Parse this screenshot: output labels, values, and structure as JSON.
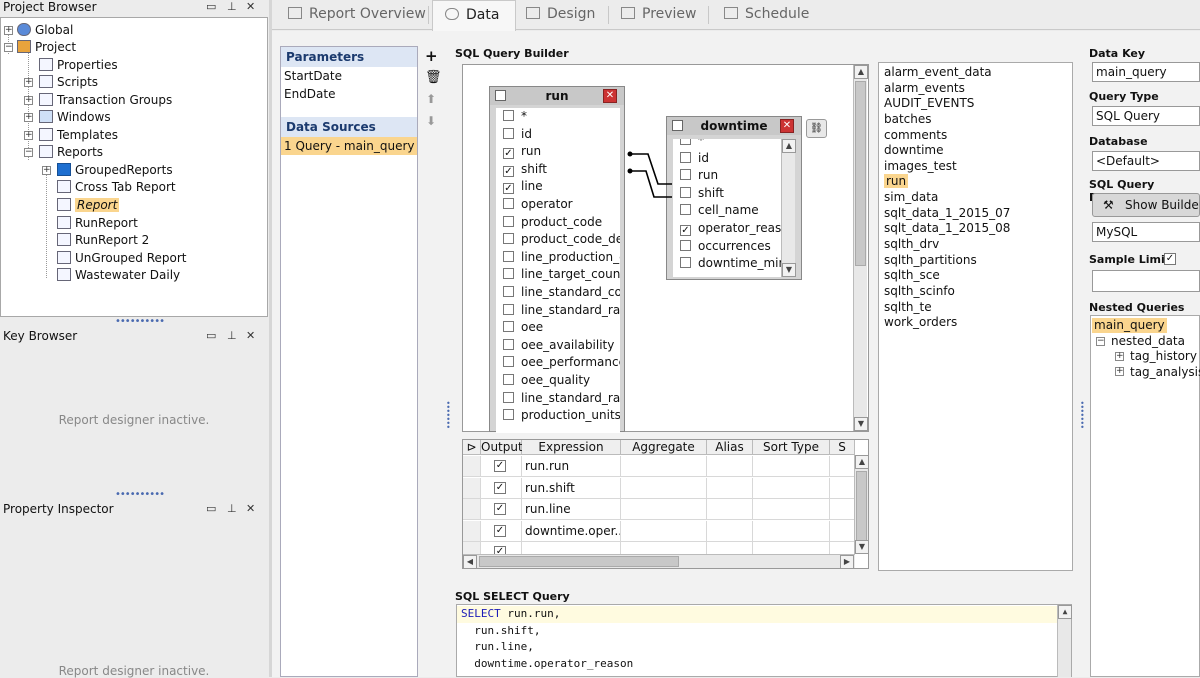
{
  "project_browser": {
    "title": "Project Browser",
    "items": [
      {
        "label": "Global"
      },
      {
        "label": "Project"
      },
      {
        "label": "Properties"
      },
      {
        "label": "Scripts"
      },
      {
        "label": "Transaction Groups"
      },
      {
        "label": "Windows"
      },
      {
        "label": "Templates"
      },
      {
        "label": "Reports"
      },
      {
        "label": "GroupedReports"
      },
      {
        "label": "Cross Tab Report"
      },
      {
        "label": "Report"
      },
      {
        "label": "RunReport"
      },
      {
        "label": "RunReport 2"
      },
      {
        "label": "UnGrouped Report"
      },
      {
        "label": "Wastewater Daily"
      }
    ]
  },
  "key_browser": {
    "title": "Key Browser",
    "inactive": "Report designer inactive."
  },
  "property_inspector": {
    "title": "Property Inspector",
    "inactive": "Report designer inactive."
  },
  "tabs": [
    {
      "label": "Report Overview",
      "icon": "overview-icon"
    },
    {
      "label": "Data",
      "icon": "database-icon"
    },
    {
      "label": "Design",
      "icon": "design-icon"
    },
    {
      "label": "Preview",
      "icon": "preview-icon"
    },
    {
      "label": "Schedule",
      "icon": "calendar-icon"
    }
  ],
  "parameters": {
    "title": "Parameters",
    "items": [
      "StartDate",
      "EndDate"
    ],
    "data_sources_title": "Data Sources",
    "data_sources": [
      "1 Query - main_query"
    ]
  },
  "query_builder": {
    "title": "SQL Query Builder",
    "run_table": {
      "name": "run",
      "fields": [
        {
          "name": "*",
          "checked": false
        },
        {
          "name": "id",
          "checked": false
        },
        {
          "name": "run",
          "checked": true
        },
        {
          "name": "shift",
          "checked": true
        },
        {
          "name": "line",
          "checked": true
        },
        {
          "name": "operator",
          "checked": false
        },
        {
          "name": "product_code",
          "checked": false
        },
        {
          "name": "product_code_des",
          "checked": false
        },
        {
          "name": "line_production_co",
          "checked": false
        },
        {
          "name": "line_target_count",
          "checked": false
        },
        {
          "name": "line_standard_cou",
          "checked": false
        },
        {
          "name": "line_standard_rate",
          "checked": false
        },
        {
          "name": "oee",
          "checked": false
        },
        {
          "name": "oee_availability",
          "checked": false
        },
        {
          "name": "oee_performance",
          "checked": false
        },
        {
          "name": "oee_quality",
          "checked": false
        },
        {
          "name": "line_standard_rate",
          "checked": false
        },
        {
          "name": "production_units",
          "checked": false
        }
      ]
    },
    "downtime_table": {
      "name": "downtime",
      "fields": [
        {
          "name": "*",
          "checked": false
        },
        {
          "name": "id",
          "checked": false
        },
        {
          "name": "run",
          "checked": false
        },
        {
          "name": "shift",
          "checked": false
        },
        {
          "name": "cell_name",
          "checked": false
        },
        {
          "name": "operator_reason",
          "checked": true
        },
        {
          "name": "occurrences",
          "checked": false
        },
        {
          "name": "downtime_minu",
          "checked": false
        }
      ]
    },
    "grid": {
      "columns": [
        "Output",
        "Expression",
        "Aggregate",
        "Alias",
        "Sort Type",
        "S"
      ],
      "rows": [
        {
          "output": true,
          "expression": "run.run"
        },
        {
          "output": true,
          "expression": "run.shift"
        },
        {
          "output": true,
          "expression": "run.line"
        },
        {
          "output": true,
          "expression": "downtime.oper..."
        }
      ]
    },
    "tables_list": [
      "alarm_event_data",
      "alarm_events",
      "AUDIT_EVENTS",
      "batches",
      "comments",
      "downtime",
      "images_test",
      "run",
      "sim_data",
      "sqlt_data_1_2015_07",
      "sqlt_data_1_2015_08",
      "sqlth_drv",
      "sqlth_partitions",
      "sqlth_sce",
      "sqlth_scinfo",
      "sqlth_te",
      "work_orders"
    ]
  },
  "sql_select": {
    "title": "SQL SELECT Query",
    "lines": [
      {
        "kw": "SELECT",
        "text": " run.run,"
      },
      {
        "kw": "",
        "text": "  run.shift,"
      },
      {
        "kw": "",
        "text": "  run.line,"
      },
      {
        "kw": "",
        "text": "  downtime.operator_reason"
      }
    ]
  },
  "right_panel": {
    "data_key_label": "Data Key",
    "data_key_value": "main_query",
    "query_type_label": "Query Type",
    "query_type_value": "SQL Query",
    "database_label": "Database",
    "database_value": "<Default>",
    "builder_label": "SQL Query Builder",
    "show_builder_button": "Show Builder",
    "dialect_value": "MySQL",
    "sample_limit_label": "Sample Limit",
    "sample_limit_checked": true,
    "nested_label": "Nested Queries",
    "nested": [
      "main_query",
      "nested_data",
      "tag_history",
      "tag_analysis"
    ]
  }
}
